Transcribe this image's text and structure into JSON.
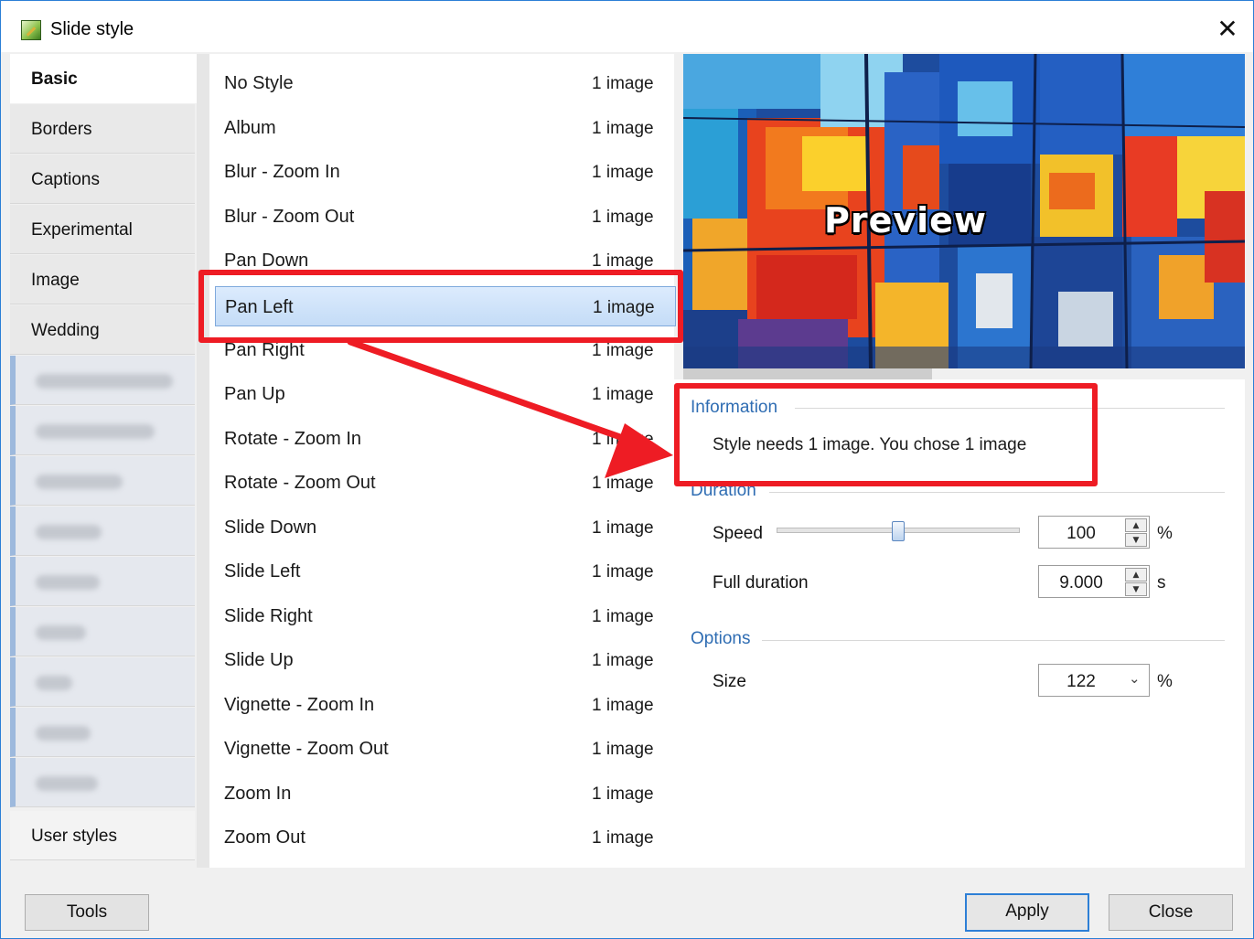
{
  "window": {
    "title": "Slide style"
  },
  "tabs": [
    {
      "label": "Basic",
      "active": true
    },
    {
      "label": "Borders"
    },
    {
      "label": "Captions"
    },
    {
      "label": "Experimental"
    },
    {
      "label": "Image"
    },
    {
      "label": "Wedding"
    }
  ],
  "user_styles_tab": "User styles",
  "styles": [
    {
      "name": "No Style",
      "count": "1 image"
    },
    {
      "name": "Album",
      "count": "1 image"
    },
    {
      "name": "Blur - Zoom In",
      "count": "1 image"
    },
    {
      "name": "Blur - Zoom Out",
      "count": "1 image"
    },
    {
      "name": "Pan Down",
      "count": "1 image"
    },
    {
      "name": "Pan Left",
      "count": "1 image",
      "selected": true
    },
    {
      "name": "Pan Right",
      "count": "1 image"
    },
    {
      "name": "Pan Up",
      "count": "1 image"
    },
    {
      "name": "Rotate - Zoom In",
      "count": "1 image"
    },
    {
      "name": "Rotate - Zoom Out",
      "count": "1 image"
    },
    {
      "name": "Slide Down",
      "count": "1 image"
    },
    {
      "name": "Slide Left",
      "count": "1 image"
    },
    {
      "name": "Slide Right",
      "count": "1 image"
    },
    {
      "name": "Slide Up",
      "count": "1 image"
    },
    {
      "name": "Vignette - Zoom In",
      "count": "1 image"
    },
    {
      "name": "Vignette - Zoom Out",
      "count": "1 image"
    },
    {
      "name": "Zoom In",
      "count": "1 image"
    },
    {
      "name": "Zoom Out",
      "count": "1 image"
    }
  ],
  "preview": {
    "label": "Preview"
  },
  "information": {
    "title": "Information",
    "text": "Style needs 1 image. You chose 1 image"
  },
  "duration": {
    "title": "Duration",
    "speed_label": "Speed",
    "speed_value": "100",
    "speed_unit": "%",
    "speed_slider_fraction": 0.5,
    "full_duration_label": "Full duration",
    "full_duration_value": "9.000",
    "full_duration_unit": "s"
  },
  "options": {
    "title": "Options",
    "size_label": "Size",
    "size_value": "122",
    "size_unit": "%"
  },
  "buttons": {
    "tools": "Tools",
    "apply": "Apply",
    "close": "Close"
  },
  "colors": {
    "accent": "#2d7fd6",
    "annotation": "#ee1c24",
    "group_title": "#2f6db3"
  }
}
